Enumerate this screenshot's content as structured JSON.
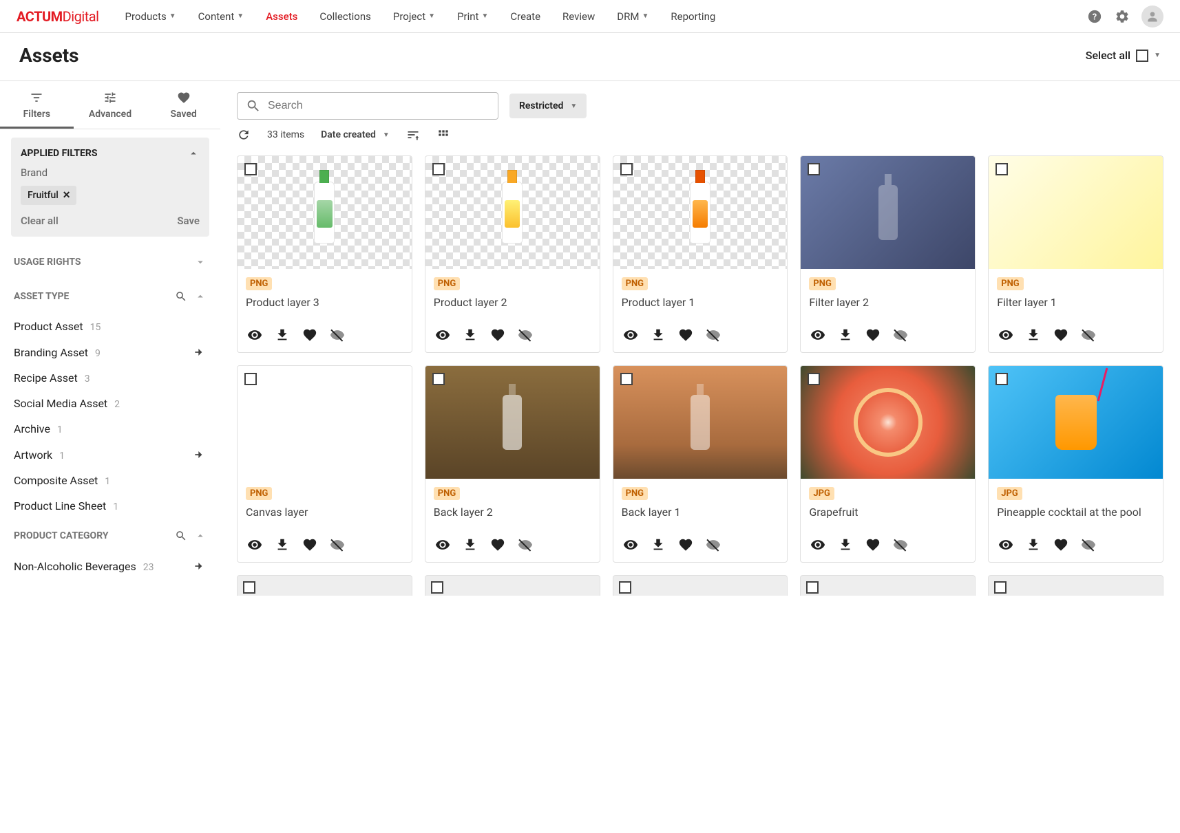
{
  "brand": {
    "bold": "ACTUM",
    "light": "Digital"
  },
  "nav": {
    "products": "Products",
    "content": "Content",
    "assets": "Assets",
    "collections": "Collections",
    "project": "Project",
    "print": "Print",
    "create": "Create",
    "review": "Review",
    "drm": "DRM",
    "reporting": "Reporting"
  },
  "page": {
    "title": "Assets",
    "select_all": "Select all"
  },
  "filter_tabs": {
    "filters": "Filters",
    "advanced": "Advanced",
    "saved": "Saved"
  },
  "applied": {
    "header": "APPLIED FILTERS",
    "brand_label": "Brand",
    "chip": "Fruitful",
    "clear": "Clear all",
    "save": "Save"
  },
  "sections": {
    "usage_rights": "USAGE RIGHTS",
    "asset_type": "ASSET TYPE",
    "product_category": "PRODUCT CATEGORY"
  },
  "asset_types": [
    {
      "label": "Product Asset",
      "count": "15",
      "arrow": false
    },
    {
      "label": "Branding Asset",
      "count": "9",
      "arrow": true
    },
    {
      "label": "Recipe Asset",
      "count": "3",
      "arrow": false
    },
    {
      "label": "Social Media Asset",
      "count": "2",
      "arrow": false
    },
    {
      "label": "Archive",
      "count": "1",
      "arrow": false
    },
    {
      "label": "Artwork",
      "count": "1",
      "arrow": true
    },
    {
      "label": "Composite Asset",
      "count": "1",
      "arrow": false
    },
    {
      "label": "Product Line Sheet",
      "count": "1",
      "arrow": false
    }
  ],
  "product_categories": [
    {
      "label": "Non-Alcoholic Beverages",
      "count": "23",
      "arrow": true
    }
  ],
  "toolbar": {
    "search_placeholder": "Search",
    "restricted": "Restricted",
    "item_count": "33 items",
    "sort": "Date created"
  },
  "formats": {
    "png": "PNG",
    "jpg": "JPG"
  },
  "cards": [
    {
      "title": "Product layer 3",
      "fmt": "png",
      "thumb": "bottle-green"
    },
    {
      "title": "Product layer 2",
      "fmt": "png",
      "thumb": "bottle-yellow"
    },
    {
      "title": "Product layer 1",
      "fmt": "png",
      "thumb": "bottle-orange"
    },
    {
      "title": "Filter layer 2",
      "fmt": "png",
      "thumb": "filter1"
    },
    {
      "title": "Filter layer 1",
      "fmt": "png",
      "thumb": "filter2"
    },
    {
      "title": "Canvas layer",
      "fmt": "png",
      "thumb": "blank"
    },
    {
      "title": "Back layer 2",
      "fmt": "png",
      "thumb": "back1"
    },
    {
      "title": "Back layer 1",
      "fmt": "png",
      "thumb": "back2"
    },
    {
      "title": "Grapefruit",
      "fmt": "jpg",
      "thumb": "grapefruit"
    },
    {
      "title": "Pineapple cocktail at the pool",
      "fmt": "jpg",
      "thumb": "pineapple"
    }
  ]
}
